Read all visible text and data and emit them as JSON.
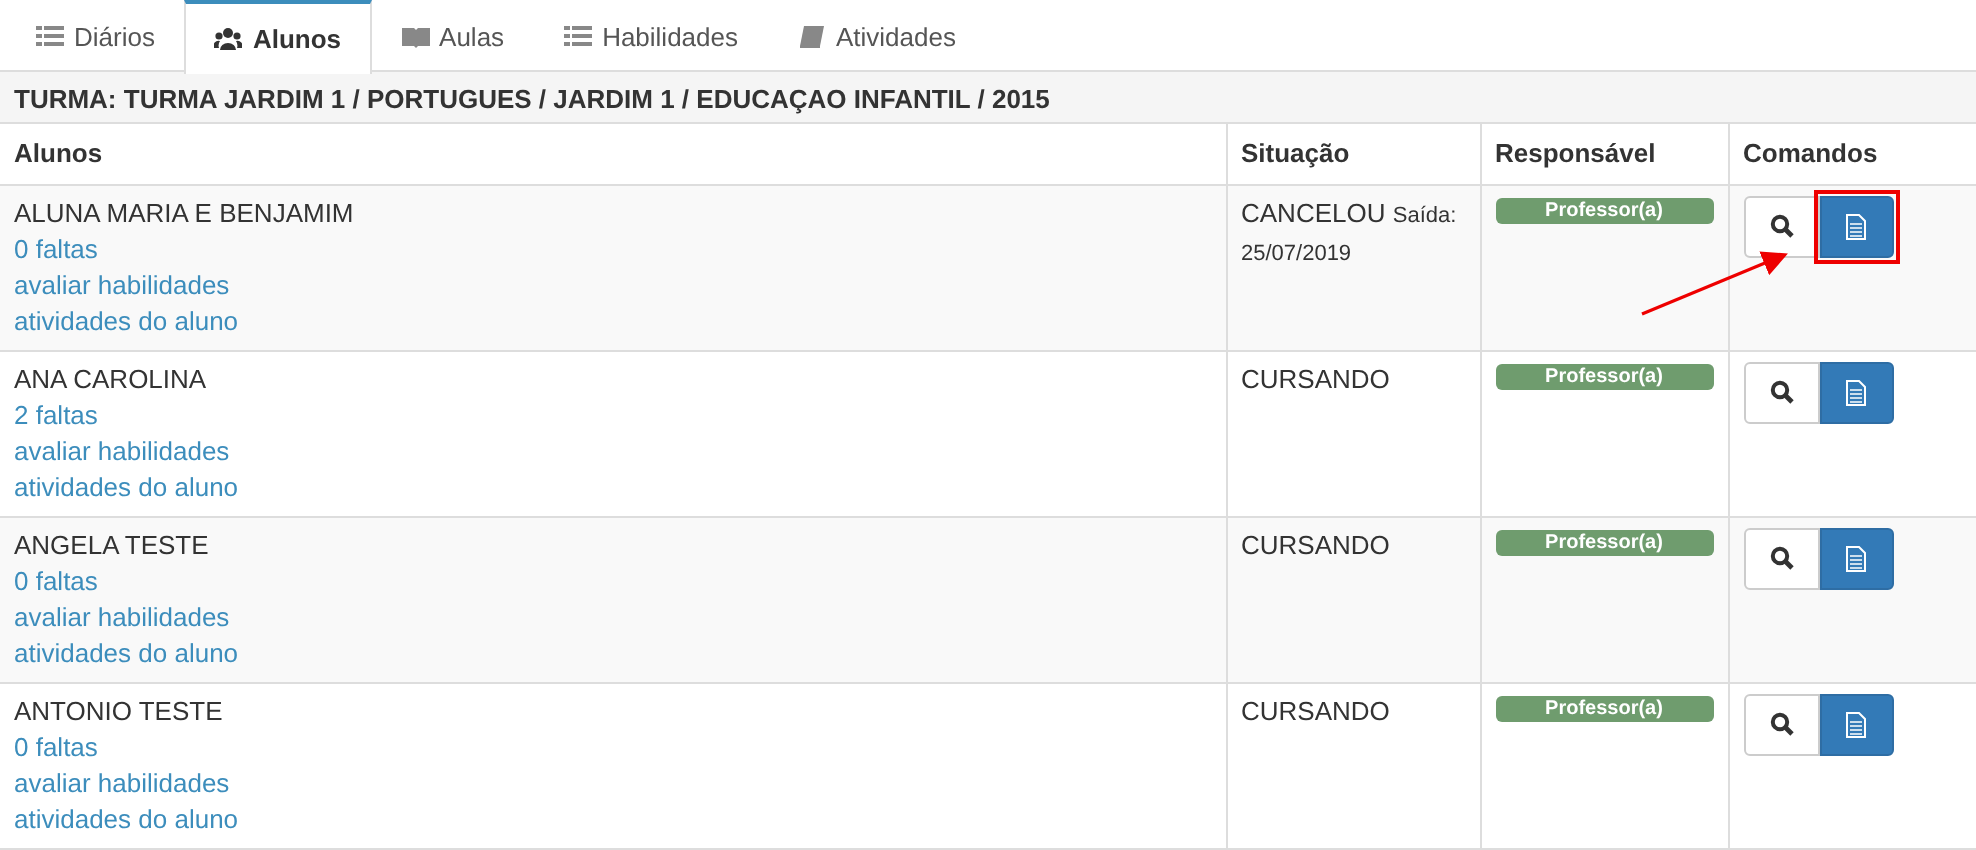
{
  "tabs": [
    {
      "label": "Diários",
      "kind": "list",
      "selected": false
    },
    {
      "label": "Alunos",
      "kind": "users",
      "selected": true
    },
    {
      "label": "Aulas",
      "kind": "openbook",
      "selected": false
    },
    {
      "label": "Habilidades",
      "kind": "list",
      "selected": false
    },
    {
      "label": "Atividades",
      "kind": "book",
      "selected": false
    }
  ],
  "table": {
    "title": "TURMA: TURMA JARDIM 1 / PORTUGUES / JARDIM 1 / EDUCAÇAO INFANTIL / 2015",
    "columns": [
      "Alunos",
      "Situação",
      "Responsável",
      "Comandos"
    ],
    "rows": [
      {
        "name": "ALUNA MARIA E BENJAMIM",
        "links": [
          "0 faltas",
          "avaliar habilidades",
          "atividades do aluno"
        ],
        "status": "CANCELOU",
        "status_note": "Saída: 25/07/2019",
        "responsible": "Professor(a)",
        "highlighted": true
      },
      {
        "name": "ANA CAROLINA",
        "links": [
          "2 faltas",
          "avaliar habilidades",
          "atividades do aluno"
        ],
        "status": "CURSANDO",
        "responsible": "Professor(a)",
        "highlighted": false
      },
      {
        "name": "ANGELA TESTE",
        "links": [
          "0 faltas",
          "avaliar habilidades",
          "atividades do aluno"
        ],
        "status": "CURSANDO",
        "responsible": "Professor(a)",
        "highlighted": false
      },
      {
        "name": "ANTONIO TESTE",
        "links": [
          "0 faltas",
          "avaliar habilidades",
          "atividades do aluno"
        ],
        "status": "CURSANDO",
        "responsible": "Professor(a)",
        "highlighted": false
      }
    ]
  }
}
